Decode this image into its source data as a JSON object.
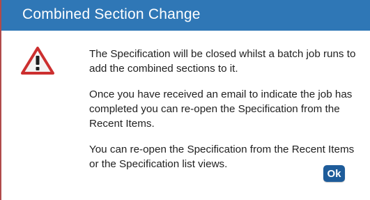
{
  "dialog": {
    "title": "Combined Section Change",
    "icon": "warning-triangle-icon",
    "messages": [
      "The Specification will be closed whilst a batch job runs to add the combined sections to it.",
      "Once you have received an email to indicate the job has completed you can re-open the Specification from the Recent Items.",
      "You can re-open the Specification from the Recent Items or the Specification list views."
    ],
    "ok_label": "Ok"
  },
  "colors": {
    "titlebar": "#2f77b6",
    "ok_button": "#1e5c9a",
    "warning_red": "#cc2f2f"
  }
}
